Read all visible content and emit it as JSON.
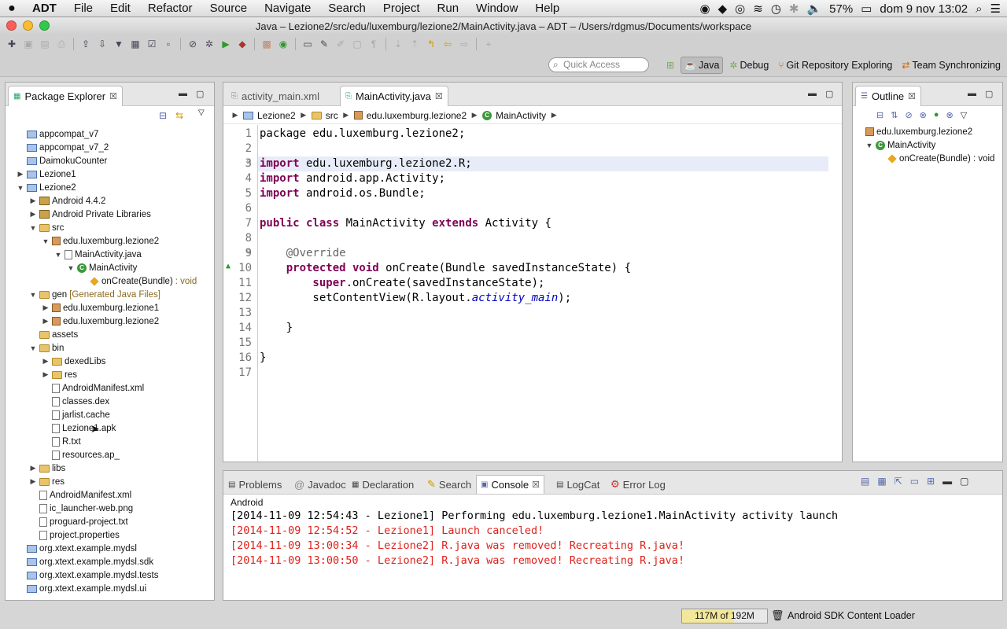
{
  "menubar": {
    "apple": "",
    "app": "ADT",
    "items": [
      "File",
      "Edit",
      "Refactor",
      "Source",
      "Navigate",
      "Search",
      "Project",
      "Run",
      "Window",
      "Help"
    ],
    "battery": "57%",
    "clock": "dom 9 nov  13:02"
  },
  "window": {
    "title": "Java – Lezione2/src/edu/luxemburg/lezione2/MainActivity.java – ADT – /Users/rdgmus/Documents/workspace"
  },
  "quick_access": {
    "placeholder": "Quick Access"
  },
  "perspectives": [
    {
      "label": "Java",
      "active": true
    },
    {
      "label": "Debug",
      "active": false
    },
    {
      "label": "Git Repository Exploring",
      "active": false
    },
    {
      "label": "Team Synchronizing",
      "active": false
    }
  ],
  "package_explorer": {
    "title": "Package Explorer",
    "tree": [
      {
        "label": "appcompat_v7",
        "kind": "proj",
        "level": 0,
        "arrow": ""
      },
      {
        "label": "appcompat_v7_2",
        "kind": "proj",
        "level": 0,
        "arrow": ""
      },
      {
        "label": "DaimokuCounter",
        "kind": "proj",
        "level": 0,
        "arrow": ""
      },
      {
        "label": "Lezione1",
        "kind": "proj",
        "level": 0,
        "arrow": "▶"
      },
      {
        "label": "Lezione2",
        "kind": "proj",
        "level": 0,
        "arrow": "▼"
      },
      {
        "label": "Android 4.4.2",
        "kind": "lib",
        "level": 1,
        "arrow": "▶"
      },
      {
        "label": "Android Private Libraries",
        "kind": "lib",
        "level": 1,
        "arrow": "▶"
      },
      {
        "label": "src",
        "kind": "folder",
        "level": 1,
        "arrow": "▼"
      },
      {
        "label": "edu.luxemburg.lezione2",
        "kind": "pkg",
        "level": 2,
        "arrow": "▼"
      },
      {
        "label": "MainActivity.java",
        "kind": "file",
        "level": 3,
        "arrow": "▼"
      },
      {
        "label": "MainActivity",
        "kind": "cls",
        "level": 4,
        "arrow": "▼"
      },
      {
        "label": "onCreate(Bundle)",
        "suffix": " : void",
        "kind": "meth",
        "level": 5,
        "arrow": ""
      },
      {
        "label": "gen",
        "suffix": " [Generated Java Files]",
        "kind": "folder",
        "level": 1,
        "arrow": "▼"
      },
      {
        "label": "edu.luxemburg.lezione1",
        "kind": "pkg",
        "level": 2,
        "arrow": "▶"
      },
      {
        "label": "edu.luxemburg.lezione2",
        "kind": "pkg",
        "level": 2,
        "arrow": "▶"
      },
      {
        "label": "assets",
        "kind": "folder",
        "level": 1,
        "arrow": ""
      },
      {
        "label": "bin",
        "kind": "folder",
        "level": 1,
        "arrow": "▼"
      },
      {
        "label": "dexedLibs",
        "kind": "folder",
        "level": 2,
        "arrow": "▶"
      },
      {
        "label": "res",
        "kind": "folder",
        "level": 2,
        "arrow": "▶"
      },
      {
        "label": "AndroidManifest.xml",
        "kind": "file",
        "level": 2,
        "arrow": ""
      },
      {
        "label": "classes.dex",
        "kind": "file",
        "level": 2,
        "arrow": ""
      },
      {
        "label": "jarlist.cache",
        "kind": "file",
        "level": 2,
        "arrow": ""
      },
      {
        "label": "Lezione1.apk",
        "kind": "file",
        "level": 2,
        "arrow": ""
      },
      {
        "label": "R.txt",
        "kind": "file",
        "level": 2,
        "arrow": ""
      },
      {
        "label": "resources.ap_",
        "kind": "file",
        "level": 2,
        "arrow": ""
      },
      {
        "label": "libs",
        "kind": "folder",
        "level": 1,
        "arrow": "▶"
      },
      {
        "label": "res",
        "kind": "folder",
        "level": 1,
        "arrow": "▶"
      },
      {
        "label": "AndroidManifest.xml",
        "kind": "file",
        "level": 1,
        "arrow": ""
      },
      {
        "label": "ic_launcher-web.png",
        "kind": "file",
        "level": 1,
        "arrow": ""
      },
      {
        "label": "proguard-project.txt",
        "kind": "file",
        "level": 1,
        "arrow": ""
      },
      {
        "label": "project.properties",
        "kind": "file",
        "level": 1,
        "arrow": ""
      },
      {
        "label": "org.xtext.example.mydsl",
        "kind": "proj",
        "level": 0,
        "arrow": ""
      },
      {
        "label": "org.xtext.example.mydsl.sdk",
        "kind": "proj",
        "level": 0,
        "arrow": ""
      },
      {
        "label": "org.xtext.example.mydsl.tests",
        "kind": "proj",
        "level": 0,
        "arrow": ""
      },
      {
        "label": "org.xtext.example.mydsl.ui",
        "kind": "proj",
        "level": 0,
        "arrow": ""
      }
    ]
  },
  "editor": {
    "tabs": [
      {
        "label": "activity_main.xml",
        "active": false
      },
      {
        "label": "MainActivity.java",
        "active": true
      }
    ],
    "breadcrumb": [
      "Lezione2",
      "src",
      "edu.luxemburg.lezione2",
      "MainActivity"
    ],
    "lines": [
      [
        {
          "t": "package edu.luxemburg.lezione2;",
          "c": ""
        }
      ],
      [],
      [
        {
          "t": "import",
          "c": "kw"
        },
        {
          "t": " edu.luxemburg.lezione2.R;",
          "c": ""
        }
      ],
      [
        {
          "t": "import",
          "c": "kw"
        },
        {
          "t": " android.app.Activity;",
          "c": ""
        }
      ],
      [
        {
          "t": "import",
          "c": "kw"
        },
        {
          "t": " android.os.Bundle;",
          "c": ""
        }
      ],
      [],
      [
        {
          "t": "public class",
          "c": "kw"
        },
        {
          "t": " MainActivity ",
          "c": ""
        },
        {
          "t": "extends",
          "c": "kw"
        },
        {
          "t": " Activity {",
          "c": ""
        }
      ],
      [],
      [
        {
          "t": "    @Override",
          "c": "ann"
        }
      ],
      [
        {
          "t": "    protected void",
          "c": "kw"
        },
        {
          "t": " onCreate(Bundle savedInstanceState) {",
          "c": ""
        }
      ],
      [
        {
          "t": "        super",
          "c": "kw"
        },
        {
          "t": ".onCreate(savedInstanceState);",
          "c": ""
        }
      ],
      [
        {
          "t": "        setContentView(R.layout.",
          "c": ""
        },
        {
          "t": "activity_main",
          "c": "fld"
        },
        {
          "t": ");",
          "c": ""
        }
      ],
      [],
      [
        {
          "t": "    }",
          "c": ""
        }
      ],
      [],
      [
        {
          "t": "}",
          "c": ""
        }
      ],
      []
    ]
  },
  "outline": {
    "title": "Outline",
    "items": [
      {
        "label": "edu.luxemburg.lezione2",
        "kind": "pkg",
        "level": 0
      },
      {
        "label": "MainActivity",
        "kind": "cls",
        "level": 0
      },
      {
        "label": "onCreate(Bundle) : void",
        "kind": "meth",
        "level": 1
      }
    ]
  },
  "console": {
    "tabs": [
      "Problems",
      "Javadoc",
      "Declaration",
      "Search",
      "Console",
      "LogCat",
      "Error Log"
    ],
    "active": "Console",
    "label": "Android",
    "lines": [
      {
        "text": "[2014-11-09 12:54:43 - Lezione1] Performing edu.luxemburg.lezione1.MainActivity activity launch",
        "color": "#000000"
      },
      {
        "text": "[2014-11-09 12:54:52 - Lezione1] Launch canceled!",
        "color": "#e0201a"
      },
      {
        "text": "[2014-11-09 13:00:34 - Lezione2] R.java was removed! Recreating R.java!",
        "color": "#e0201a"
      },
      {
        "text": "[2014-11-09 13:00:50 - Lezione2] R.java was removed! Recreating R.java!",
        "color": "#e0201a"
      }
    ]
  },
  "status": {
    "heap": "117M of 192M",
    "heap_fraction": 0.61,
    "task": "Android SDK Content Loader"
  },
  "colors": {
    "keyword": "#7f0055",
    "field": "#0000c0",
    "error": "#e0201a"
  }
}
